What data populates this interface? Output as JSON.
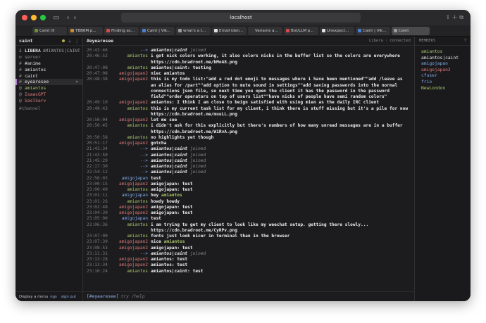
{
  "browser": {
    "url": "localhost",
    "tabs": [
      {
        "label": "Caint (lI",
        "color": "#6b8e3a"
      },
      {
        "label": "TBB6M p...",
        "color": "#c98a2b"
      },
      {
        "label": "Finding ac...",
        "color": "#d14b4b"
      },
      {
        "label": "Caint | Vik...",
        "color": "#4a7fd1"
      },
      {
        "label": "what's a t...",
        "color": "#9a9a9a"
      },
      {
        "label": "Email iden...",
        "color": "#e0e0e0"
      },
      {
        "label": "Variants a...",
        "color": "#333333"
      },
      {
        "label": "Bot/LLM p...",
        "color": "#d14b4b"
      },
      {
        "label": "Unexpect...",
        "color": "#e0e0e0"
      },
      {
        "label": "Caint | Vik...",
        "color": "#4a7fd1"
      },
      {
        "label": "Caint",
        "color": "#9a9a9a"
      }
    ]
  },
  "sidebar": {
    "title": "caint",
    "items": [
      {
        "pfx": "i",
        "label": "LIBERA",
        "sub": "AMIANTOS|CAINT",
        "type": "network"
      },
      {
        "pfx": "⊘",
        "label": "server",
        "type": "dim"
      },
      {
        "pfx": "#",
        "label": "#anime",
        "type": "chan"
      },
      {
        "pfx": "#",
        "label": "amiantos",
        "type": "chan"
      },
      {
        "pfx": "#",
        "label": "caint",
        "type": "chan"
      },
      {
        "pfx": "#",
        "label": "eyearesee",
        "type": "active"
      },
      {
        "pfx": "@",
        "label": "amiantos",
        "type": "nick-green"
      },
      {
        "pfx": "@",
        "label": "IsaacGPT",
        "type": "nick-red"
      },
      {
        "pfx": "@",
        "label": "SaslServ",
        "type": "nick-red"
      }
    ],
    "new_channel_placeholder": "#channel",
    "footer": {
      "text": "Display a menu",
      "link1": "ngs",
      "link2": "sign out"
    }
  },
  "channel": {
    "name": "#eyearesee",
    "network": "Libera",
    "status": "connected"
  },
  "messages": [
    {
      "ts": "20:43:46",
      "nick": "-->",
      "text": "amiantos|caint",
      "suffix": "joined",
      "kind": "join"
    },
    {
      "ts": "20:46:52",
      "nick": "amiantos",
      "text": "i got nick colors working, it also colors nicks in the buffer list so the colors are everywhere",
      "kind": "msg",
      "ncolor": "#a8c66c"
    },
    {
      "ts": "",
      "nick": "",
      "text": "https://cdn.bradroot.me/bMoA8.png",
      "kind": "cont"
    },
    {
      "ts": "20:47:08",
      "nick": "amiantos",
      "text": "amiantos|caint: testing",
      "kind": "msg",
      "ncolor": "#a8c66c"
    },
    {
      "ts": "20:47:08",
      "nick": "amigojapan2",
      "text": "niec amiantos",
      "kind": "msg",
      "ncolor": "#e07b7b"
    },
    {
      "ts": "20:48:38",
      "nick": "amigojapan2",
      "text": "this is my todo list:\"add a red dot emoji to messages where i have been mentioned\"\"add /leave as",
      "kind": "msg",
      "ncolor": "#e07b7b"
    },
    {
      "ts": "",
      "nick": "",
      "text": "an alias for /part\"\"add option to mute sound in settings\"\"add saving passwords into the normal",
      "kind": "cont"
    },
    {
      "ts": "",
      "nick": "",
      "text": "connections json file, so next time you open the client it has the password in the password",
      "kind": "cont"
    },
    {
      "ts": "",
      "nick": "",
      "text": "field\"\"order operators on top of users list\"\"have nicks of people have semi random colors\"",
      "kind": "cont"
    },
    {
      "ts": "20:49:10",
      "nick": "amigojapan2",
      "text": "amiantos: I think I am close to beign satisfied with using mien as the daily IRC client",
      "kind": "msg",
      "ncolor": "#e07b7b"
    },
    {
      "ts": "20:49:43",
      "nick": "amiantos",
      "text": "this is my current task list for my client, i think there is stuff missing but it's a pile for now",
      "kind": "msg",
      "ncolor": "#a8c66c"
    },
    {
      "ts": "",
      "nick": "",
      "text": "https://cdn.bradroot.me/muuLL.png",
      "kind": "cont"
    },
    {
      "ts": "20:50:04",
      "nick": "amigojapan2",
      "text": "let me see",
      "kind": "msg",
      "ncolor": "#e07b7b"
    },
    {
      "ts": "20:50:45",
      "nick": "amiantos",
      "text": "i didn't ask for this explicitly but there's numbers of how many unread messages are in a buffer",
      "kind": "msg",
      "ncolor": "#a8c66c"
    },
    {
      "ts": "",
      "nick": "",
      "text": "https://cdn.bradroot.me/W1RvA.png",
      "kind": "cont"
    },
    {
      "ts": "20:50:58",
      "nick": "amiantos",
      "text": "no highlights yet though",
      "kind": "msg",
      "ncolor": "#a8c66c"
    },
    {
      "ts": "20:51:17",
      "nick": "amigojapan2",
      "text": "gotcha",
      "kind": "msg",
      "ncolor": "#e07b7b"
    },
    {
      "ts": "21:43:34",
      "nick": "-->",
      "text": "amiantos|caint",
      "suffix": "joined",
      "kind": "join"
    },
    {
      "ts": "21:43:50",
      "nick": "-->",
      "text": "amiantos|caint",
      "suffix": "joined",
      "kind": "join"
    },
    {
      "ts": "21:45:29",
      "nick": "-->",
      "text": "amiantos|caint",
      "suffix": "joined",
      "kind": "join"
    },
    {
      "ts": "22:17:30",
      "nick": "-->",
      "text": "amiantos|caint",
      "suffix": "joined",
      "kind": "join"
    },
    {
      "ts": "22:54:12",
      "nick": "-->",
      "text": "amiantos|caint",
      "suffix": "joined",
      "kind": "join"
    },
    {
      "ts": "22:56:03",
      "nick": "amigojapan",
      "text": "test",
      "kind": "msg",
      "ncolor": "#7fa8e8"
    },
    {
      "ts": "23:00:15",
      "nick": "amigojapan2",
      "text": "amigojapan: test",
      "kind": "msg",
      "ncolor": "#e07b7b"
    },
    {
      "ts": "23:00:49",
      "nick": "amiantos",
      "text": "amigojapan: test",
      "kind": "msg",
      "ncolor": "#a8c66c"
    },
    {
      "ts": "23:01:11",
      "nick": "amigojapan",
      "text": "hey amiantos",
      "kind": "msg",
      "ncolor": "#7fa8e8",
      "mention": "amiantos"
    },
    {
      "ts": "23:01:26",
      "nick": "amiantos",
      "text": "howdy howdy",
      "kind": "msg",
      "ncolor": "#a8c66c"
    },
    {
      "ts": "23:02:48",
      "nick": "amigojapan2",
      "text": "amigojapan: test",
      "kind": "msg",
      "ncolor": "#e07b7b"
    },
    {
      "ts": "23:04:39",
      "nick": "amigojapan2",
      "text": "amigojapan: test",
      "kind": "msg",
      "ncolor": "#e07b7b"
    },
    {
      "ts": "23:05:00",
      "nick": "amigojapan",
      "text": "test",
      "kind": "msg",
      "ncolor": "#7fa8e8"
    },
    {
      "ts": "23:06:36",
      "nick": "amiantos",
      "text": "i am trying to get my client to look like my weechat setup. getting there slowly...",
      "kind": "msg",
      "ncolor": "#a8c66c"
    },
    {
      "ts": "",
      "nick": "",
      "text": "https://cdn.bradroot.me/CyRPv.png",
      "kind": "cont"
    },
    {
      "ts": "23:07:00",
      "nick": "amiantos",
      "text": "fonts just look nicer in terminal than in the browser",
      "kind": "msg",
      "ncolor": "#a8c66c"
    },
    {
      "ts": "23:07:39",
      "nick": "amigojapan2",
      "text": "nice amiantos",
      "kind": "msg",
      "ncolor": "#e07b7b",
      "mention": "amiantos"
    },
    {
      "ts": "23:08:53",
      "nick": "amigojapan2",
      "text": "amigojapan: test",
      "kind": "msg",
      "ncolor": "#e07b7b"
    },
    {
      "ts": "23:11:31",
      "nick": "-->",
      "text": "amiantos|caint",
      "suffix": "joined",
      "kind": "join"
    },
    {
      "ts": "23:13:28",
      "nick": "amigojapan2",
      "text": "amiantos: test",
      "kind": "msg",
      "ncolor": "#e07b7b"
    },
    {
      "ts": "23:13:34",
      "nick": "amigojapan2",
      "text": "amiantos: test",
      "kind": "msg",
      "ncolor": "#e07b7b"
    },
    {
      "ts": "23:16:24",
      "nick": "amiantos",
      "text": "amiantos|caint: test",
      "kind": "msg",
      "ncolor": "#a8c66c"
    }
  ],
  "input": {
    "channel_prefix": "[#eyearesee]",
    "placeholder": "try /help"
  },
  "members": {
    "title": "MEMBERS",
    "count": "7",
    "list": [
      {
        "name": "amiantos",
        "color": "#a8c66c"
      },
      {
        "name": "amiantos|caint",
        "color": "#ececee"
      },
      {
        "name": "amigojapan",
        "color": "#7fa8e8"
      },
      {
        "name": "amigojapan2",
        "color": "#e07b7b"
      },
      {
        "name": "cfuser",
        "color": "#7fa8e8"
      },
      {
        "name": "frio",
        "color": "#7fa8e8"
      },
      {
        "name": "NewLondon",
        "color": "#a8c66c"
      }
    ]
  }
}
